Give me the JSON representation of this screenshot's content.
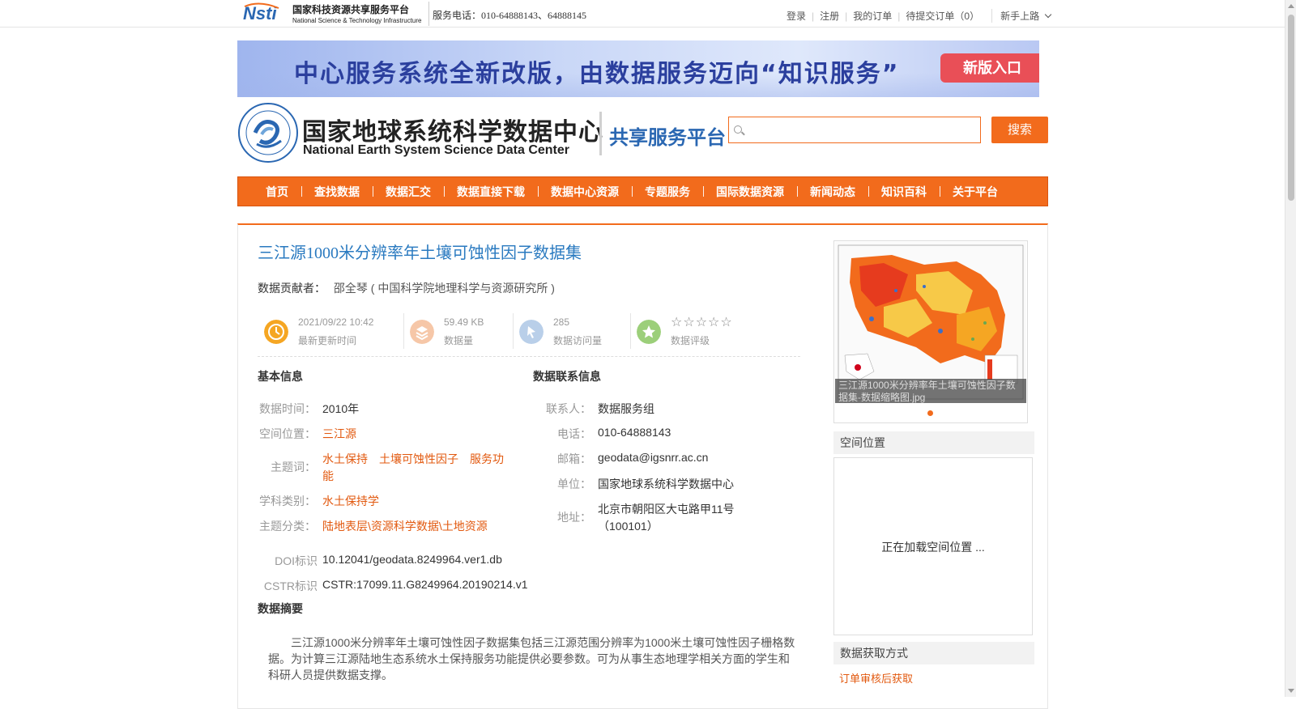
{
  "topbar": {
    "logo_cn": "国家科技资源共享服务平台",
    "logo_en": "National Science & Technology Infrastructure",
    "service_phone": "服务电话：010-64888143、64888145",
    "links": [
      "登录",
      "注册",
      "我的订单",
      "待提交订单（0）"
    ],
    "newbie": "新手上路"
  },
  "banner": {
    "text": "中心服务系统全新改版，由数据服务迈向“知识服务”",
    "button": "新版入口"
  },
  "header": {
    "title_cn": "国家地球系统科学数据中心",
    "title_en": "National Earth System Science Data Center",
    "platform": "共享服务平台",
    "search_placeholder": "",
    "search_button": "搜索"
  },
  "nav": [
    "首页",
    "查找数据",
    "数据汇交",
    "数据直接下载",
    "数据中心资源",
    "专题服务",
    "国际数据资源",
    "新闻动态",
    "知识百科",
    "关于平台"
  ],
  "dataset": {
    "title": "三江源1000米分辨率年土壤可蚀性因子数据集",
    "contributor_label": "数据贡献者：",
    "contributor": "邵全琴 ( 中国科学院地理科学与资源研究所 )",
    "stats": [
      {
        "value": "2021/09/22 10:42",
        "label": "最新更新时间",
        "icon": "clock-icon",
        "color": "#f5a623"
      },
      {
        "value": "59.49 KB",
        "label": "数据量",
        "icon": "layers-icon",
        "color": "#f6c7a8"
      },
      {
        "value": "285",
        "label": "数据访问量",
        "icon": "visit-icon",
        "color": "#b9cfe9"
      },
      {
        "value": "☆☆☆☆☆",
        "label": "数据评级",
        "icon": "star-icon",
        "color": "#9ccf7a"
      }
    ],
    "basic": {
      "heading": "基本信息",
      "time_label": "数据时间：",
      "time": "2010年",
      "space_label": "空间位置：",
      "space": "三江源",
      "keywords_label": "主题词：",
      "keywords": [
        "水土保持",
        "土壤可蚀性因子",
        "服务功能"
      ],
      "subject_label": "学科类别：",
      "subject": "水土保持学",
      "category_label": "主题分类：",
      "category": "陆地表层\\资源科学数据\\土地资源",
      "doi_label": "DOI标识",
      "doi": "10.12041/geodata.8249964.ver1.db",
      "cstr_label": "CSTR标识",
      "cstr": "CSTR:17099.11.G8249964.20190214.v1"
    },
    "contact": {
      "heading": "数据联系信息",
      "person_label": "联系人：",
      "person": "数据服务组",
      "phone_label": "电话：",
      "phone": "010-64888143",
      "email_label": "邮箱：",
      "email": "geodata@igsnrr.ac.cn",
      "unit_label": "单位：",
      "unit": "国家地球系统科学数据中心",
      "address_label": "地址：",
      "address": "北京市朝阳区大屯路甲11号（100101）"
    },
    "abstract_heading": "数据摘要",
    "abstract": "三江源1000米分辨率年土壤可蚀性因子数据集包括三江源范围分辨率为1000米土壤可蚀性因子栅格数据。为计算三江源陆地生态系统水土保持服务功能提供必要参数。可为从事生态地理学相关方面的学生和科研人员提供数据支撑。"
  },
  "sidebar": {
    "thumb_caption": "三江源1000米分辨率年土壤可蚀性因子数据集-数据缩略图.jpg",
    "space_heading": "空间位置",
    "map_loading": "正在加载空间位置 ...",
    "access_heading": "数据获取方式",
    "access_link": "订单审核后获取"
  }
}
